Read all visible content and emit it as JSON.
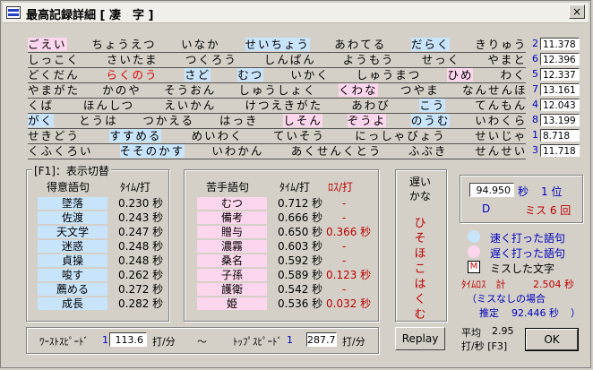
{
  "window": {
    "title": "最高記録詳細 [ 凄　字 ]",
    "close_label": "×"
  },
  "rows": [
    {
      "num": "2",
      "time": "11.378"
    },
    {
      "num": "6",
      "time": "12.396"
    },
    {
      "num": "5",
      "time": "12.337"
    },
    {
      "num": "7",
      "time": "13.161"
    },
    {
      "num": "4",
      "time": "12.043"
    },
    {
      "num": "8",
      "time": "13.199"
    },
    {
      "num": "1",
      "time": "8.718"
    },
    {
      "num": "3",
      "time": "11.718"
    }
  ],
  "words": [
    [
      {
        "t": "ごえい",
        "c": "slow"
      },
      {
        "t": "ちょうえつ",
        "c": ""
      },
      {
        "t": "いなか",
        "c": ""
      },
      {
        "t": "せいちょう",
        "c": "fast"
      },
      {
        "t": "あわてる",
        "c": ""
      },
      {
        "t": "だらく",
        "c": "fast"
      },
      {
        "t": "きりゅう",
        "c": ""
      }
    ],
    [
      {
        "t": "しっこく",
        "c": ""
      },
      {
        "t": "さいたま",
        "c": ""
      },
      {
        "t": "つくろう",
        "c": ""
      },
      {
        "t": "しんぱん",
        "c": ""
      },
      {
        "t": "ようもう",
        "c": ""
      },
      {
        "t": "せっく",
        "c": ""
      },
      {
        "t": "やまと",
        "c": ""
      }
    ],
    [
      {
        "t": "どくだん",
        "c": ""
      },
      {
        "t": "らくのう",
        "c": "mis"
      },
      {
        "t": "さど",
        "c": "fast"
      },
      {
        "t": "むつ",
        "c": "fast"
      },
      {
        "t": "いかく",
        "c": ""
      },
      {
        "t": "しゅうまつ",
        "c": ""
      },
      {
        "t": "ひめ",
        "c": "slow"
      },
      {
        "t": "わく",
        "c": ""
      }
    ],
    [
      {
        "t": "やまがた",
        "c": ""
      },
      {
        "t": "かのや",
        "c": ""
      },
      {
        "t": "そうおん",
        "c": ""
      },
      {
        "t": "しゅうしょく",
        "c": ""
      },
      {
        "t": "くわな",
        "c": "slow"
      },
      {
        "t": "つやま",
        "c": ""
      },
      {
        "t": "なんせんほ",
        "c": ""
      }
    ],
    [
      {
        "t": "くば",
        "c": ""
      },
      {
        "t": "ほんしつ",
        "c": ""
      },
      {
        "t": "えいかん",
        "c": ""
      },
      {
        "t": "けつえきがた",
        "c": ""
      },
      {
        "t": "あわび",
        "c": ""
      },
      {
        "t": "こう",
        "c": "fast"
      },
      {
        "t": "てんもん",
        "c": ""
      }
    ],
    [
      {
        "t": "がく",
        "c": "fast"
      },
      {
        "t": "とうは",
        "c": ""
      },
      {
        "t": "つかえる",
        "c": ""
      },
      {
        "t": "はっき",
        "c": ""
      },
      {
        "t": "しそん",
        "c": "slow"
      },
      {
        "t": "ぞうよ",
        "c": "slow"
      },
      {
        "t": "のうむ",
        "c": "fast"
      },
      {
        "t": "いわくら",
        "c": ""
      }
    ],
    [
      {
        "t": "せきどう",
        "c": ""
      },
      {
        "t": "すすめる",
        "c": "fast"
      },
      {
        "t": "めいわく",
        "c": ""
      },
      {
        "t": "ていそう",
        "c": ""
      },
      {
        "t": "にっしゃびょう",
        "c": ""
      },
      {
        "t": "せいじゃ",
        "c": ""
      }
    ],
    [
      {
        "t": "くふくろい",
        "c": ""
      },
      {
        "t": "そそのかす",
        "c": "fast"
      },
      {
        "t": "いわかん",
        "c": ""
      },
      {
        "t": "あくせんくとう",
        "c": ""
      },
      {
        "t": "ふぶき",
        "c": ""
      },
      {
        "t": "せんせい",
        "c": ""
      }
    ]
  ],
  "good": {
    "group_title": "[F1]：表示切替",
    "col_word": "得意語句",
    "col_time": "ﾀｲﾑ/打",
    "items": [
      {
        "w": "墜落",
        "t": "0.230 秒"
      },
      {
        "w": "佐渡",
        "t": "0.243 秒"
      },
      {
        "w": "天文学",
        "t": "0.247 秒"
      },
      {
        "w": "迷惑",
        "t": "0.248 秒"
      },
      {
        "w": "貞操",
        "t": "0.248 秒"
      },
      {
        "w": "唆す",
        "t": "0.262 秒"
      },
      {
        "w": "薦める",
        "t": "0.272 秒"
      },
      {
        "w": "成長",
        "t": "0.282 秒"
      }
    ]
  },
  "bad": {
    "col_word": "苦手語句",
    "col_time": "ﾀｲﾑ/打",
    "col_loss": "ﾛｽ/打",
    "items": [
      {
        "w": "むつ",
        "t": "0.712 秒",
        "l": "-"
      },
      {
        "w": "備考",
        "t": "0.666 秒",
        "l": "-"
      },
      {
        "w": "贈与",
        "t": "0.650 秒",
        "l": "0.366 秒"
      },
      {
        "w": "濃霧",
        "t": "0.603 秒",
        "l": "-"
      },
      {
        "w": "桑名",
        "t": "0.592 秒",
        "l": "-"
      },
      {
        "w": "子孫",
        "t": "0.589 秒",
        "l": "0.123 秒"
      },
      {
        "w": "護衛",
        "t": "0.542 秒",
        "l": "-"
      },
      {
        "w": "姫",
        "t": "0.536 秒",
        "l": "0.032 秒"
      }
    ]
  },
  "slow_kana": {
    "label1": "遅い",
    "label2": "かな",
    "chars": [
      "ひ",
      "そ",
      "ほ",
      "こ",
      "は",
      "く",
      "む"
    ]
  },
  "stats": {
    "total_time": "94.950",
    "sec_unit": "秒",
    "rank": "1 位",
    "grade": "D",
    "miss": "ミス 6 回"
  },
  "legend": {
    "fast": "速く打った語句",
    "slow": "遅く打った語句",
    "miss_mark": "M",
    "miss": "ミスした文字"
  },
  "time_loss": {
    "label": "ﾀｲﾑﾛｽ　計",
    "value": "2.504 秒",
    "note": "（ミスなしの場合",
    "est_label": "推定",
    "est_value": "92.446 秒",
    "close_paren": "）"
  },
  "speed": {
    "worst_label": "ﾜｰｽﾄｽﾋﾟｰﾄﾞ",
    "worst_num": "1",
    "worst_value": "113.6",
    "unit": "打/分",
    "tilde": "～",
    "top_label": "ﾄｯﾌﾟｽﾋﾟｰﾄﾞ",
    "top_num": "1",
    "top_value": "287.7",
    "unit2": "打/分"
  },
  "average": {
    "label": "平均",
    "value": "2.95",
    "unit": "打/秒 [F3]"
  },
  "buttons": {
    "replay": "Replay",
    "ok": "OK"
  }
}
